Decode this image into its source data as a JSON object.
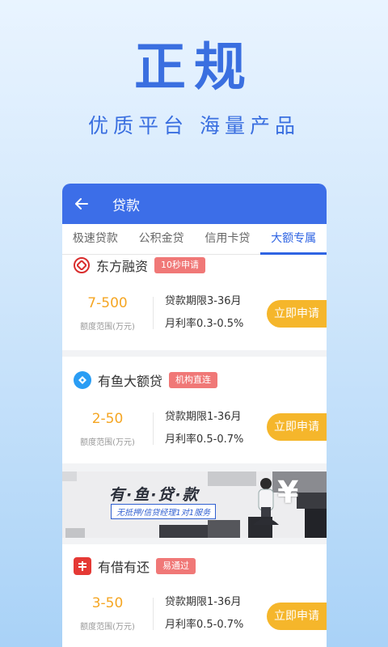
{
  "hero": {
    "title": "正规",
    "subtitle": "优质平台  海量产品"
  },
  "appbar": {
    "title": "贷款"
  },
  "tabs": [
    {
      "label": "极速贷款"
    },
    {
      "label": "公积金贷"
    },
    {
      "label": "信用卡贷"
    },
    {
      "label": "大额专属",
      "active": true
    }
  ],
  "cards": [
    {
      "name": "东方融资",
      "tag": "10秒申请",
      "amount": "7-500",
      "amount_label": "额度范围(万元)",
      "term": "贷款期限3-36月",
      "rate": "月利率0.3-0.5%",
      "apply": "立即申请"
    },
    {
      "name": "有鱼大额贷",
      "tag": "机构直连",
      "amount": "2-50",
      "amount_label": "额度范围(万元)",
      "term": "贷款期限1-36月",
      "rate": "月利率0.5-0.7%",
      "apply": "立即申请"
    },
    {
      "name": "有借有还",
      "tag": "易通过",
      "amount": "3-50",
      "amount_label": "额度范围(万元)",
      "term": "贷款期限1-36月",
      "rate": "月利率0.5-0.7%",
      "apply": "立即申请"
    }
  ],
  "banner": {
    "title": "有·鱼·贷·款",
    "subtitle": "无抵押/信贷经理1对1服务",
    "logo_text": "¥"
  },
  "colors": {
    "primary": "#3c6ee8",
    "accent": "#f5b62b",
    "amount": "#f5a623",
    "tag": "#f07877"
  }
}
